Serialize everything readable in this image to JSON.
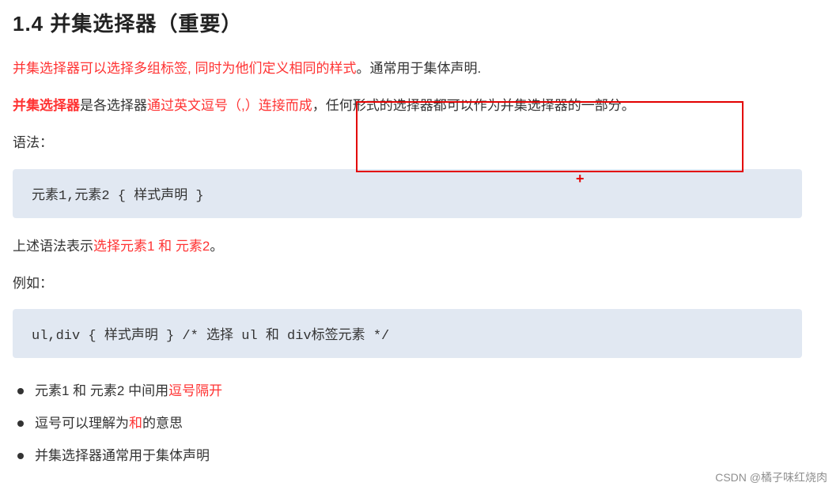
{
  "heading": "1.4 并集选择器（重要）",
  "para1": {
    "red": "并集选择器可以选择多组标签, 同时为他们定义相同的样式",
    "rest": "。通常用于集体声明."
  },
  "para2": {
    "strong": "并集选择器",
    "mid": "是各选择器",
    "red": "通过英文逗号（,）连接而成",
    "rest2": "，任何形式的选择器都可以作为并集选择器的一部分。"
  },
  "syntax_label": "语法：",
  "code1": "元素1,元素2 {  样式声明  }",
  "para3": {
    "pre": "上述语法表示",
    "red": "选择元素1 和 元素2",
    "post": "。"
  },
  "for_example": "例如：",
  "code2": "ul,div {  样式声明  }   /*   选择 ul 和   div标签元素   */",
  "bullets": [
    {
      "pre": "元素1 和 元素2 中间用",
      "red": "逗号隔开",
      "post": ""
    },
    {
      "pre": "逗号可以理解为",
      "red": "和",
      "post": "的意思"
    },
    {
      "pre": "并集选择器通常用于集体声明",
      "red": "",
      "post": ""
    }
  ],
  "watermark": "CSDN @橘子味红烧肉"
}
